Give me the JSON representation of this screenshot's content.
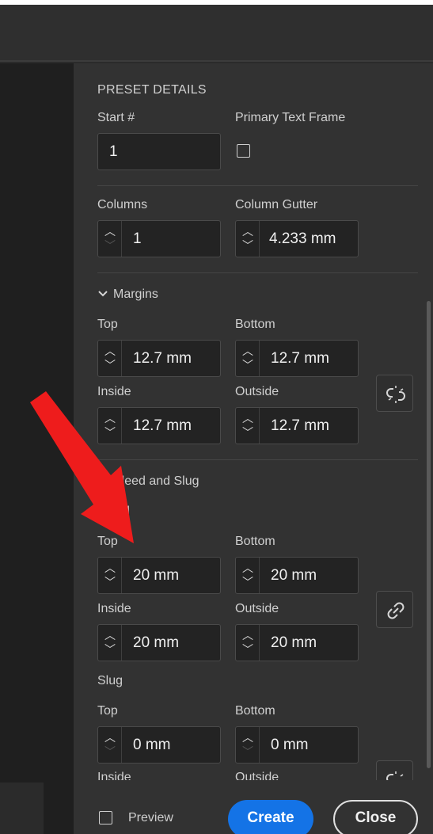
{
  "preset": {
    "heading": "PRESET DETAILS",
    "start_label": "Start #",
    "start_value": "1",
    "primary_text_frame_label": "Primary Text Frame",
    "columns_label": "Columns",
    "columns_value": "1",
    "gutter_label": "Column Gutter",
    "gutter_value": "4.233 mm"
  },
  "margins": {
    "title": "Margins",
    "top_label": "Top",
    "top_value": "12.7 mm",
    "bottom_label": "Bottom",
    "bottom_value": "12.7 mm",
    "inside_label": "Inside",
    "inside_value": "12.7 mm",
    "outside_label": "Outside",
    "outside_value": "12.7 mm"
  },
  "bleed_slug": {
    "title": "Bleed and Slug",
    "bleed_label": "Bleed",
    "bleed_top_label": "Top",
    "bleed_top_value": "20 mm",
    "bleed_bottom_label": "Bottom",
    "bleed_bottom_value": "20 mm",
    "bleed_inside_label": "Inside",
    "bleed_inside_value": "20 mm",
    "bleed_outside_label": "Outside",
    "bleed_outside_value": "20 mm",
    "slug_label": "Slug",
    "slug_top_label": "Top",
    "slug_top_value": "0 mm",
    "slug_bottom_label": "Bottom",
    "slug_bottom_value": "0 mm",
    "slug_inside_label": "Inside",
    "slug_outside_label": "Outside"
  },
  "footer": {
    "preview_label": "Preview",
    "create_label": "Create",
    "close_label": "Close"
  },
  "colors": {
    "accent": "#1473e6",
    "annotation_arrow": "#ee1c1c"
  },
  "icons": [
    "checkbox",
    "stepper-up-icon",
    "stepper-down-icon",
    "chevron-down-icon",
    "unlink-icon",
    "link-icon"
  ]
}
